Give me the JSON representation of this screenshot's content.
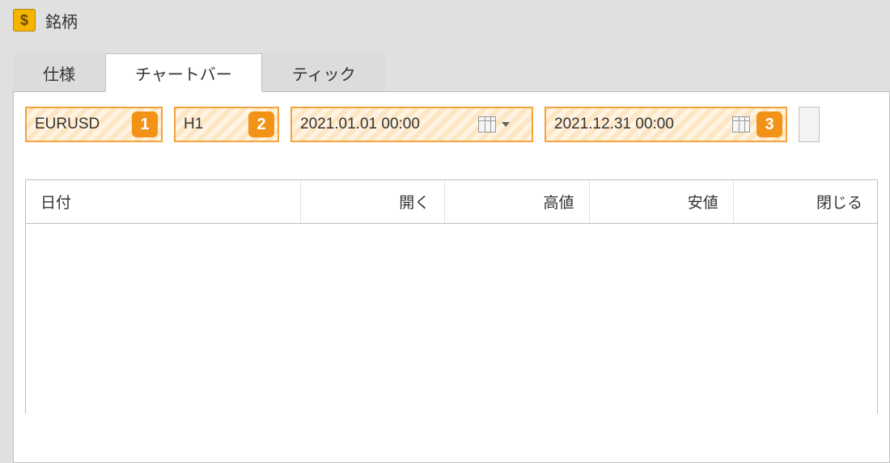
{
  "window": {
    "title": "銘柄",
    "icon_glyph": "$"
  },
  "tabs": {
    "spec": "仕様",
    "chartbar": "チャートバー",
    "tick": "ティック",
    "active": "chartbar"
  },
  "filters": {
    "symbol": {
      "value": "EURUSD",
      "badge": "1"
    },
    "timeframe": {
      "value": "H1",
      "badge": "2"
    },
    "date_from": {
      "value": "2021.01.01 00:00"
    },
    "date_to": {
      "value": "2021.12.31 00:00",
      "badge": "3"
    }
  },
  "table": {
    "columns": {
      "date": "日付",
      "open": "開く",
      "high": "高値",
      "low": "安値",
      "close": "閉じる"
    },
    "rows": []
  },
  "colors": {
    "highlight_border": "#f2a33c",
    "badge_bg": "#f29217"
  }
}
